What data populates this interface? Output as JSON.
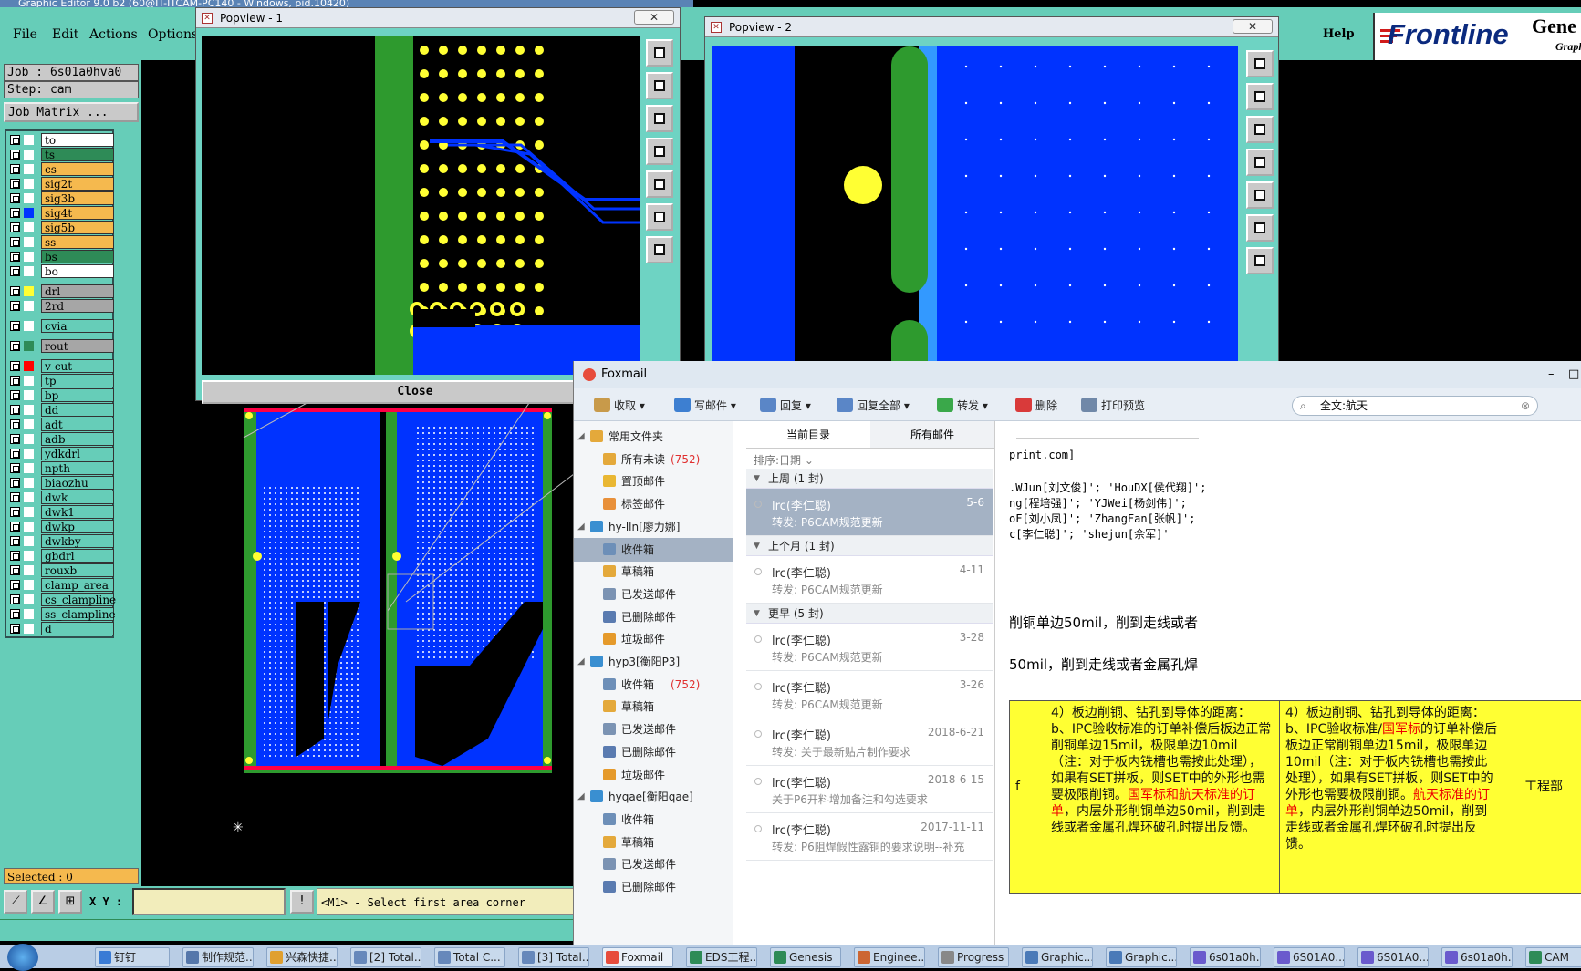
{
  "genesis": {
    "title_bar": "Graphic Editor 9.0 b2 (60@IT-ITCAM-PC140 - Windows, pid.10420)",
    "menu": [
      "File",
      "Edit",
      "Actions",
      "Options"
    ],
    "help": "Help",
    "brand": {
      "name": "Frontline",
      "product": "Gene",
      "sub": "Graph"
    },
    "job": "Job : 6s01a0hva0",
    "step": "Step: cam",
    "job_matrix": "Job Matrix ...",
    "layers": [
      {
        "name": "to",
        "bg": "#ffffff",
        "color": "#ffffff"
      },
      {
        "name": "ts",
        "bg": "#2e8b57",
        "color": "#ffffff"
      },
      {
        "name": "cs",
        "bg": "#f5b94e",
        "color": "#ffffff"
      },
      {
        "name": "sig2t",
        "bg": "#f5b94e",
        "color": "#ffffff"
      },
      {
        "name": "sig3b",
        "bg": "#f5b94e",
        "color": "#ffffff"
      },
      {
        "name": "sig4t",
        "bg": "#f5b94e",
        "color": "#0033ff"
      },
      {
        "name": "sig5b",
        "bg": "#f5b94e",
        "color": "#ffffff"
      },
      {
        "name": "ss",
        "bg": "#f5b94e",
        "color": "#ffffff"
      },
      {
        "name": "bs",
        "bg": "#2e8b57",
        "color": "#ffffff"
      },
      {
        "name": "bo",
        "bg": "#ffffff",
        "color": "#ffffff"
      },
      {
        "name": "drl",
        "bg": "#a6a6a6",
        "color": "#ffff33"
      },
      {
        "name": "2rd",
        "bg": "#a6a6a6",
        "color": "#ffffff"
      },
      {
        "name": "cvia",
        "bg": "#66cdb8",
        "color": "#ffffff"
      },
      {
        "name": "rout",
        "bg": "#a6a6a6",
        "color": "#2e8b57"
      },
      {
        "name": "v-cut",
        "bg": "#66cdb8",
        "color": "#ff0000"
      },
      {
        "name": "tp",
        "bg": "#66cdb8",
        "color": "#ffffff"
      },
      {
        "name": "bp",
        "bg": "#66cdb8",
        "color": "#ffffff"
      },
      {
        "name": "dd",
        "bg": "#66cdb8",
        "color": "#ffffff"
      },
      {
        "name": "adt",
        "bg": "#66cdb8",
        "color": "#ffffff"
      },
      {
        "name": "adb",
        "bg": "#66cdb8",
        "color": "#ffffff"
      },
      {
        "name": "ydkdrl",
        "bg": "#66cdb8",
        "color": "#ffffff"
      },
      {
        "name": "npth",
        "bg": "#66cdb8",
        "color": "#ffffff"
      },
      {
        "name": "biaozhu",
        "bg": "#66cdb8",
        "color": "#ffffff"
      },
      {
        "name": "dwk",
        "bg": "#66cdb8",
        "color": "#ffffff"
      },
      {
        "name": "dwk1",
        "bg": "#66cdb8",
        "color": "#ffffff"
      },
      {
        "name": "dwkp",
        "bg": "#66cdb8",
        "color": "#ffffff"
      },
      {
        "name": "dwkby",
        "bg": "#66cdb8",
        "color": "#ffffff"
      },
      {
        "name": "gbdrl",
        "bg": "#66cdb8",
        "color": "#ffffff"
      },
      {
        "name": "rouxb",
        "bg": "#66cdb8",
        "color": "#ffffff"
      },
      {
        "name": "clamp_area",
        "bg": "#66cdb8",
        "color": "#ffffff"
      },
      {
        "name": "cs_clampline",
        "bg": "#66cdb8",
        "color": "#ffffff"
      },
      {
        "name": "ss_clampline",
        "bg": "#66cdb8",
        "color": "#ffffff"
      },
      {
        "name": "d",
        "bg": "#66cdb8",
        "color": "#ffffff"
      }
    ],
    "selected": "Selected : 0",
    "xy_label": "X Y :",
    "message": "<M1> - Select first area corner"
  },
  "popview1": {
    "title": "Popview - 1",
    "close": "Close"
  },
  "popview2": {
    "title": "Popview - 2"
  },
  "foxmail": {
    "title": "Foxmail",
    "toolbar": [
      "收取",
      "写邮件",
      "回复",
      "回复全部",
      "转发",
      "删除",
      "打印预览"
    ],
    "search": "全文:航天",
    "nav": [
      {
        "label": "常用文件夹",
        "count": ""
      },
      {
        "label": "所有未读",
        "count": "(752)"
      },
      {
        "label": "置顶邮件",
        "count": ""
      },
      {
        "label": "标签邮件",
        "count": ""
      },
      {
        "label": "hy-lln[廖力娜]",
        "count": ""
      },
      {
        "label": "收件箱",
        "count": ""
      },
      {
        "label": "草稿箱",
        "count": ""
      },
      {
        "label": "已发送邮件",
        "count": ""
      },
      {
        "label": "已删除邮件",
        "count": ""
      },
      {
        "label": "垃圾邮件",
        "count": ""
      },
      {
        "label": "hyp3[衡阳P3]",
        "count": ""
      },
      {
        "label": "收件箱",
        "count": "(752)"
      },
      {
        "label": "草稿箱",
        "count": ""
      },
      {
        "label": "已发送邮件",
        "count": ""
      },
      {
        "label": "已删除邮件",
        "count": ""
      },
      {
        "label": "垃圾邮件",
        "count": ""
      },
      {
        "label": "hyqae[衡阳qae]",
        "count": ""
      },
      {
        "label": "收件箱",
        "count": ""
      },
      {
        "label": "草稿箱",
        "count": ""
      },
      {
        "label": "已发送邮件",
        "count": ""
      },
      {
        "label": "已删除邮件",
        "count": ""
      }
    ],
    "list_tabs": [
      "当前目录",
      "所有邮件"
    ],
    "sort": "排序:日期 ⌄",
    "groups": [
      "上周 (1 封)",
      "上个月 (1 封)",
      "更早 (5 封)"
    ],
    "messages": [
      {
        "from": "lrc(李仁聪)",
        "date": "5-6",
        "subject": "转发: P6CAM规范更新"
      },
      {
        "from": "lrc(李仁聪)",
        "date": "4-11",
        "subject": "转发: P6CAM规范更新"
      },
      {
        "from": "lrc(李仁聪)",
        "date": "3-28",
        "subject": "转发: P6CAM规范更新"
      },
      {
        "from": "lrc(李仁聪)",
        "date": "3-26",
        "subject": "转发: P6CAM规范更新"
      },
      {
        "from": "lrc(李仁聪)",
        "date": "2018-6-21",
        "subject": "转发: 关于最新贴片制作要求"
      },
      {
        "from": "lrc(李仁聪)",
        "date": "2018-6-15",
        "subject": "关于P6开料增加备注和勾选要求"
      },
      {
        "from": "lrc(李仁聪)",
        "date": "2017-11-11",
        "subject": "转发: P6阻焊假性露铜的要求说明--补充"
      }
    ],
    "view": {
      "line1": "print.com]",
      "line2": ".WJun[刘文俊]'; 'HouDX[侯代翔]';",
      "line3": "ng[程培强]'; 'YJWei[杨剑伟]';",
      "line4": "oF[刘小凤]'; 'ZhangFan[张帆]';",
      "line5": "c[李仁聪]'; 'shejun[佘军]'",
      "body1": "削铜单边50mil，削到走线或者",
      "body2": "50mil，削到走线或者金属孔焊",
      "cell0": "f",
      "cell1_a": "4）板边削铜、钻孔到导体的距离：",
      "cell1_b": "b、IPC验收标准的订单补偿后板边正常削铜单边15mil，极限单边10mil（注：对于板内铣槽也需按此处理），如果有SET拼板，则SET中的外形也需要极限削铜。",
      "cell1_red": "国军标和航天标准的订单",
      "cell1_c": "，内层外形削铜单边50mil，削到走线或者金属孔焊环破孔时提出反馈。",
      "cell2_a": "4）板边削铜、钻孔到导体的距离：",
      "cell2_b1": "b、IPC验收标准/",
      "cell2_red1": "国军标",
      "cell2_b2": "的订单补偿后板边正常削铜单边15mil，极限单边10mil（注：对于板内铣槽也需按此处理），如果有SET拼板，则SET中的外形也需要极限削铜。",
      "cell2_red2": "航天标准的订单",
      "cell2_c": "，内层外形削铜单边50mil，削到走线或者金属孔焊环破孔时提出反馈。",
      "cell3": "工程部"
    }
  },
  "taskbar": [
    "钉钉",
    "制作规范...",
    "兴森快捷...",
    "[2] Total...",
    "Total C...",
    "[3] Total...",
    "Foxmail",
    "EDS工程...",
    "Genesis",
    "Enginee...",
    "Progress",
    "Graphic...",
    "Graphic...",
    "6s01a0h...",
    "6S01A0...",
    "6S01A0...",
    "6s01a0h...",
    "CAM"
  ],
  "colors": {
    "genesis_panel": "#66cdb8",
    "pcb_blue": "#0033ff",
    "pcb_green": "#2e9a2e",
    "pad_yellow": "#ffff33",
    "foxmail_accent": "#e74c3c"
  }
}
